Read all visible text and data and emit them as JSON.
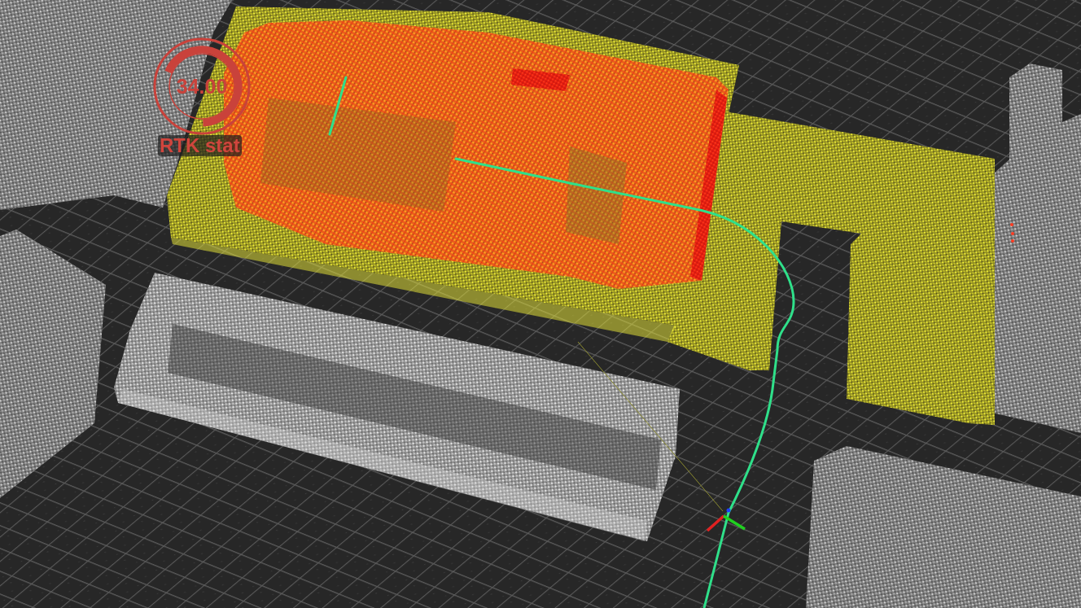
{
  "hud": {
    "gauge": {
      "value": "34.00",
      "label": "RTK stat",
      "level": 0.68
    }
  }
}
